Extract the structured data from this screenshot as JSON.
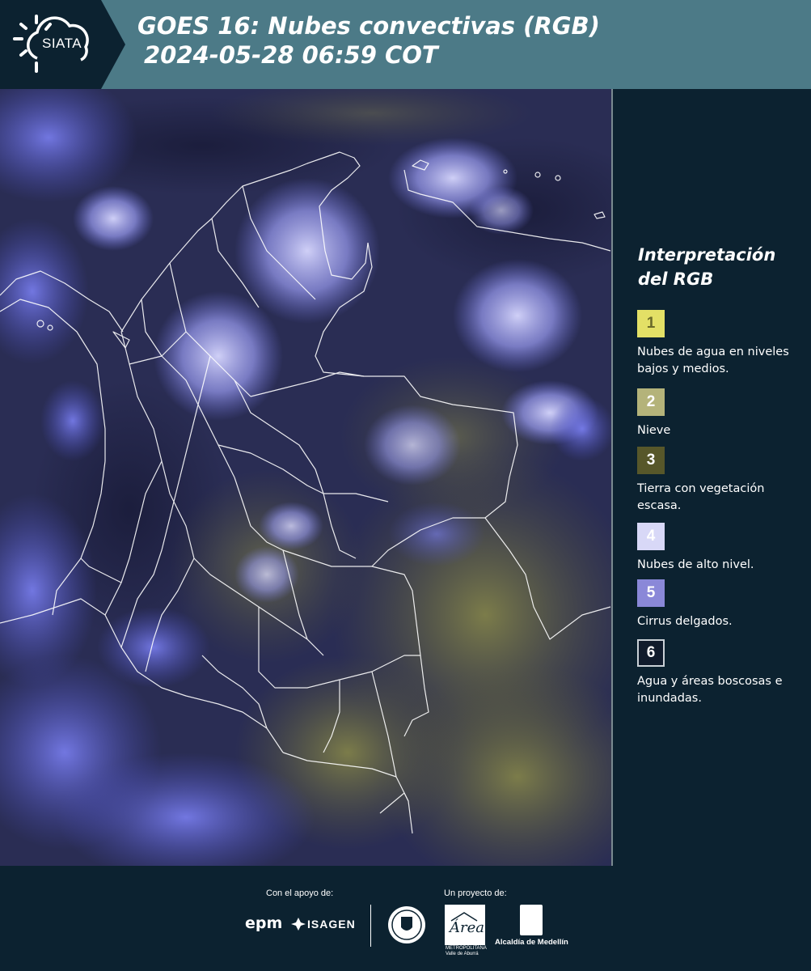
{
  "header": {
    "logo_text": "SIATA",
    "title_line1": "GOES 16: Nubes convectivas (RGB)",
    "title_line2": "2024-05-28 06:59 COT",
    "background_color": "#4c7a87"
  },
  "map": {
    "palette": {
      "background": "#23264a",
      "high_clouds": "#7f83f0",
      "bright_clouds": "#c9c9ff",
      "land_yellow": "#7a7a3c",
      "borders": "#ffffff"
    }
  },
  "legend": {
    "title": "Interpretación del RGB",
    "items": [
      {
        "number": "1",
        "label": "Nubes de agua en niveles bajos y medios.",
        "color": "#e3e066",
        "text_color": "#6a6a2a"
      },
      {
        "number": "2",
        "label": "Nieve",
        "color": "#b4b37a",
        "text_color": "#ffffff"
      },
      {
        "number": "3",
        "label": "Tierra con vegetación escasa.",
        "color": "#57572a",
        "text_color": "#ffffff"
      },
      {
        "number": "4",
        "label": "Nubes de alto nivel.",
        "color": "#d8d8f7",
        "text_color": "#ffffff"
      },
      {
        "number": "5",
        "label": "Cirrus delgados.",
        "color": "#8a88d8",
        "text_color": "#ffffff"
      },
      {
        "number": "6",
        "label": "Agua y áreas boscosas e inundadas.",
        "color": "#101b2c",
        "text_color": "#ffffff"
      }
    ]
  },
  "footer": {
    "support_label": "Con el apoyo de:",
    "project_label": "Un proyecto de:",
    "epm": "epm",
    "isagen": "ISAGEN",
    "area_text_1": "METROPOLITANA",
    "area_text_2": "Valle de Aburrá",
    "area_logo_text": "Área",
    "alcaldia": "Alcaldía de Medellín"
  }
}
